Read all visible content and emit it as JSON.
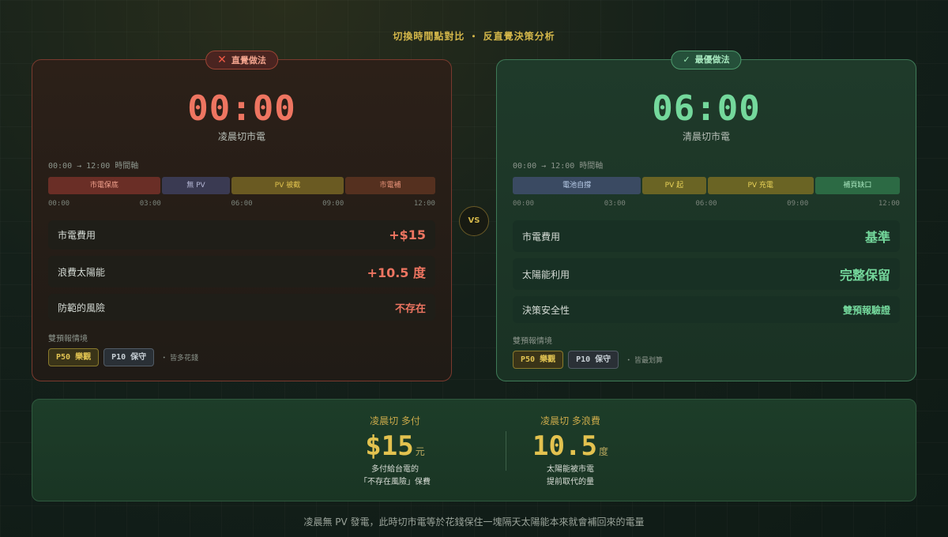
{
  "page_title": "切換時間點對比 ・ 反直覺決策分析",
  "vs_label": "VS",
  "bad": {
    "badge_icon": "✕",
    "badge_label": "直覺做法",
    "time": "00:00",
    "subtitle": "凌晨切市電",
    "axis_title": "00:00 → 12:00 時間軸",
    "segments": [
      {
        "label": "市電保底",
        "bg": "#6a2e26",
        "color": "#f0a08c",
        "flex": 133
      },
      {
        "label": "無 PV",
        "bg": "#3a3a52",
        "color": "#b4b6d4",
        "flex": 81
      },
      {
        "label": "PV 被截",
        "bg": "#6a5a22",
        "color": "#e0c24e",
        "flex": 133
      },
      {
        "label": "市電補",
        "bg": "#55301f",
        "color": "#e9947a",
        "flex": 107
      }
    ],
    "ticks": [
      "00:00",
      "03:00",
      "06:00",
      "09:00",
      "12:00"
    ],
    "metrics": [
      {
        "label": "市電費用",
        "value": "+$15"
      },
      {
        "label": "浪費太陽能",
        "value": "+10.5 度"
      },
      {
        "label": "防範的風險",
        "value": "不存在"
      }
    ],
    "scenario_title": "雙預報情境",
    "chips": [
      "P50 樂觀",
      "P10 保守"
    ],
    "scenario_note": "・ 皆多花錢"
  },
  "good": {
    "badge_icon": "✓",
    "badge_label": "最優做法",
    "time": "06:00",
    "subtitle": "清晨切市電",
    "axis_title": "00:00 → 12:00 時間軸",
    "segments": [
      {
        "label": "電池自撐",
        "bg": "#3a4a62",
        "color": "#bcd0ec",
        "flex": 133
      },
      {
        "label": "PV 起",
        "bg": "#6a6424",
        "color": "#e8d258",
        "flex": 66
      },
      {
        "label": "PV 充電",
        "bg": "#6a6424",
        "color": "#e8d258",
        "flex": 110
      },
      {
        "label": "補頁缺口",
        "bg": "#2c6a44",
        "color": "#a6e4bc",
        "flex": 88
      }
    ],
    "ticks": [
      "00:00",
      "03:00",
      "06:00",
      "09:00",
      "12:00"
    ],
    "metrics": [
      {
        "label": "市電費用",
        "value": "基準"
      },
      {
        "label": "太陽能利用",
        "value": "完整保留"
      },
      {
        "label": "決策安全性",
        "value": "雙預報驗證"
      }
    ],
    "scenario_title": "雙預報情境",
    "chips": [
      "P50 樂觀",
      "P10 保守"
    ],
    "scenario_note": "・ 皆最划算"
  },
  "summary": {
    "left": {
      "heading": "凌晨切 多付",
      "number": "$15",
      "unit": "元",
      "desc1": "多付給台電的",
      "desc2": "「不存在風險」保費"
    },
    "right": {
      "heading": "凌晨切 多浪費",
      "number": "10.5",
      "unit": "度",
      "desc1": "太陽能被市電",
      "desc2": "提前取代的量"
    }
  },
  "footer": "凌晨無 PV 發電，此時切市電等於花錢保住一塊隔天太陽能本來就會補回來的電量",
  "colors": {
    "accent_gold": "#d4b74a",
    "bad_red": "#ee7561",
    "good_green": "#74d89c"
  }
}
